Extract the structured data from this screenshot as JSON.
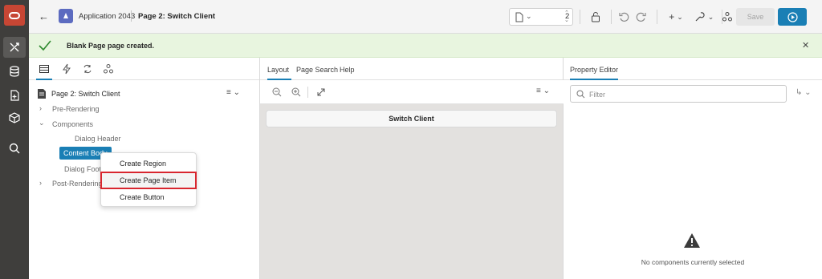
{
  "header": {
    "app_name": "Application 2043",
    "page_name": "Page 2: Switch Client",
    "page_number": "2",
    "save_label": "Save"
  },
  "banner": {
    "message": "Blank Page page created."
  },
  "tree": {
    "title": "Page 2: Switch Client",
    "nodes": {
      "pre_rendering": "Pre-Rendering",
      "components": "Components",
      "dialog_header": "Dialog Header",
      "content_body": "Content Body",
      "dialog_footer": "Dialog Foote",
      "post_rendering": "Post-Rendering"
    }
  },
  "context_menu": {
    "items": [
      "Create Region",
      "Create Page Item",
      "Create Button"
    ]
  },
  "layout": {
    "tabs": [
      "Layout",
      "Page Search",
      "Help"
    ],
    "region_title": "Switch Client"
  },
  "property_editor": {
    "tab_label": "Property Editor",
    "filter_placeholder": "Filter",
    "empty_message": "No components currently selected"
  },
  "colors": {
    "accent": "#1a7fb5",
    "brand_red": "#c74634",
    "highlight": "#d8262f",
    "success_bg": "#e8f5df",
    "rail_bg": "#3f3e3c"
  }
}
